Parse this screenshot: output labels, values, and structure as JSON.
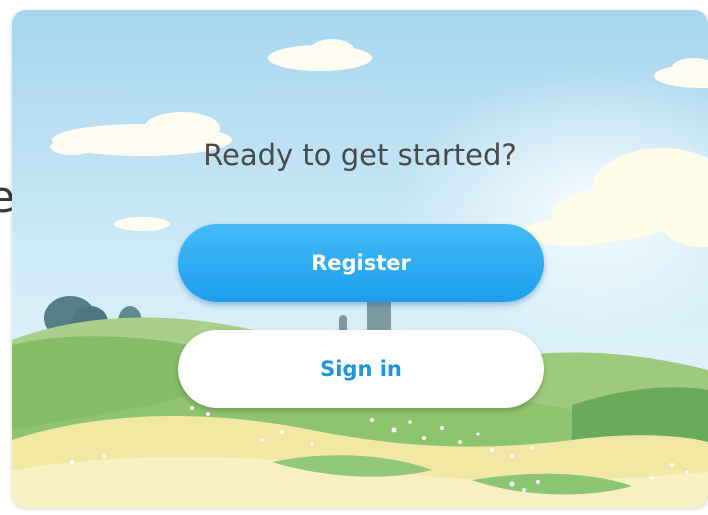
{
  "background_text": "e",
  "card": {
    "heading": "Ready to get started?",
    "register_label": "Register",
    "signin_label": "Sign in"
  },
  "colors": {
    "sky_top": "#a9d8ef",
    "sky_bottom": "#e4f4fb",
    "register_button": "#2aa8f2",
    "signin_text": "#1d94dd",
    "hill_green": "#8cc36b",
    "meadow_yellow": "#f2e9a6"
  }
}
